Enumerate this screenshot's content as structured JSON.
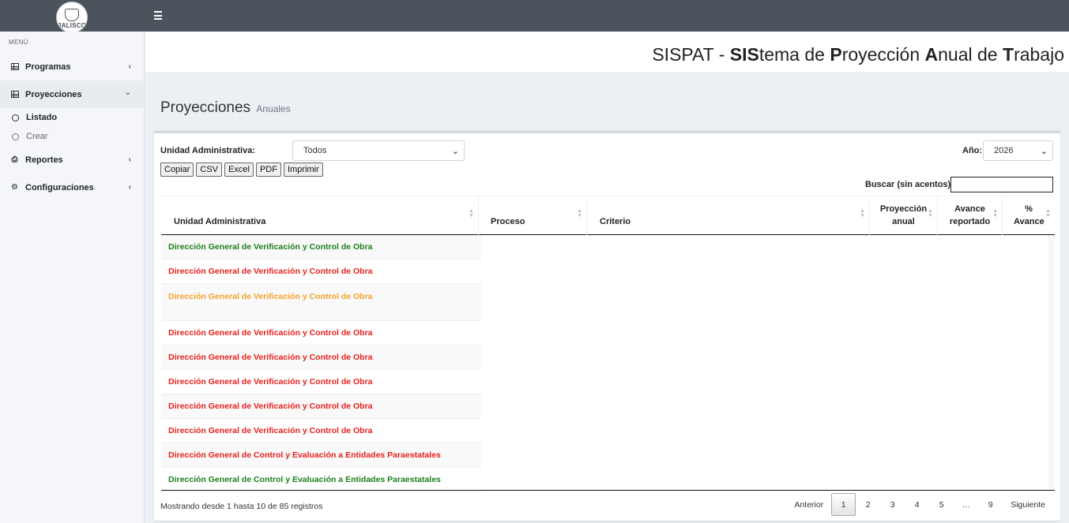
{
  "topbar": {
    "logo_text": "JALISCO"
  },
  "sidebar": {
    "header": "MENÚ",
    "items": [
      {
        "label": "Programas"
      },
      {
        "label": "Proyecciones",
        "sub": [
          {
            "label": "Listado"
          },
          {
            "label": "Crear"
          }
        ]
      },
      {
        "label": "Reportes"
      },
      {
        "label": "Configuraciones"
      }
    ]
  },
  "header": {
    "title_parts": [
      "SISPAT - ",
      "SIS",
      "tema de ",
      "P",
      "royección ",
      "A",
      "nual de ",
      "T",
      "rabajo"
    ]
  },
  "page": {
    "title": "Proyecciones",
    "subtitle": "Anuales"
  },
  "filters": {
    "ua_label": "Unidad Administrativa:",
    "ua_value": "Todos",
    "year_label": "Año:",
    "year_value": "2026",
    "search_label": "Buscar (sin acentos):",
    "search_value": ""
  },
  "export_buttons": [
    "Copiar",
    "CSV",
    "Excel",
    "PDF",
    "Imprimir"
  ],
  "table": {
    "headers": [
      "Unidad Administrativa",
      "Proceso",
      "Criterio",
      "Proyección anual",
      "Avance reportado",
      "% Avance"
    ],
    "rows": [
      {
        "ua": "Dirección General de Verificación y Control de Obra",
        "color": "#1a7f1a"
      },
      {
        "ua": "Dirección General de Verificación y Control de Obra",
        "color": "#e8201c"
      },
      {
        "ua": "Dirección General de Verificación y Control de Obra",
        "color": "#f5a12b"
      },
      {
        "ua": "Dirección General de Verificación y Control de Obra",
        "color": "#e8201c"
      },
      {
        "ua": "Dirección General de Verificación y Control de Obra",
        "color": "#e8201c"
      },
      {
        "ua": "Dirección General de Verificación y Control de Obra",
        "color": "#e8201c"
      },
      {
        "ua": "Dirección General de Verificación y Control de Obra",
        "color": "#e8201c"
      },
      {
        "ua": "Dirección General de Verificación y Control de Obra",
        "color": "#e8201c"
      },
      {
        "ua": "Dirección General de Control y Evaluación a Entidades Paraestatales",
        "color": "#e8201c"
      },
      {
        "ua": "Dirección General de Control y Evaluación a Entidades Paraestatales",
        "color": "#1a7f1a"
      }
    ]
  },
  "footer": {
    "info": "Mostrando desde 1 hasta 10 de 85 registros",
    "prev": "Anterior",
    "pages": [
      "1",
      "2",
      "3",
      "4",
      "5",
      "…",
      "9"
    ],
    "next": "Siguiente"
  }
}
